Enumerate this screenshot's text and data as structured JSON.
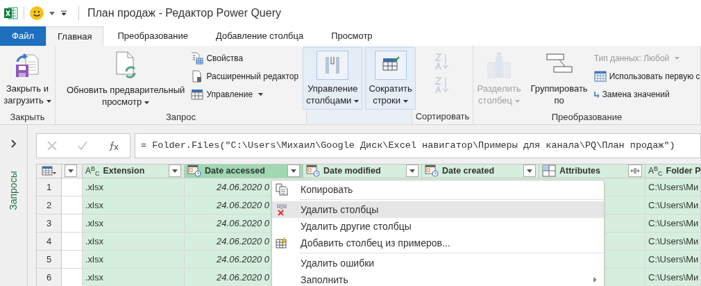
{
  "title_bar": {
    "title": "План продаж - Редактор Power Query"
  },
  "tabs": [
    {
      "label": "Файл",
      "kind": "file",
      "selected": false
    },
    {
      "label": "Главная",
      "kind": "tab",
      "selected": true
    },
    {
      "label": "Преобразование",
      "kind": "tab",
      "selected": false
    },
    {
      "label": "Добавление столбца",
      "kind": "tab",
      "selected": false
    },
    {
      "label": "Просмотр",
      "kind": "tab",
      "selected": false
    }
  ],
  "ribbon": {
    "groups": [
      {
        "label": "Закрыть",
        "items": [
          {
            "kind": "large",
            "lines": [
              "Закрыть и",
              "загрузить"
            ],
            "dropdown": true,
            "disabled": false,
            "highlighted": false
          }
        ]
      },
      {
        "label": "Запрос",
        "items": [
          {
            "kind": "large",
            "lines": [
              "Обновить предварительный",
              "просмотр"
            ],
            "dropdown": true,
            "disabled": false,
            "highlighted": false
          },
          {
            "kind": "small",
            "lines": [
              "Свойства"
            ],
            "dropdown": false,
            "disabled": false
          },
          {
            "kind": "small",
            "lines": [
              "Расширенный редактор"
            ],
            "dropdown": false,
            "disabled": false
          },
          {
            "kind": "small",
            "lines": [
              "Управление"
            ],
            "dropdown": true,
            "disabled": false
          }
        ]
      },
      {
        "items": [
          {
            "kind": "large",
            "lines": [
              "Управление",
              "столбцами"
            ],
            "dropdown": true,
            "disabled": false,
            "highlighted": true
          },
          {
            "kind": "large",
            "lines": [
              "Сократить",
              "строки"
            ],
            "dropdown": true,
            "disabled": false,
            "highlighted": true
          }
        ]
      },
      {
        "label": "Сортировать",
        "items": [
          {
            "kind": "sort",
            "disabled": true
          }
        ]
      },
      {
        "label": "Преобразование",
        "items": [
          {
            "kind": "large",
            "lines": [
              "Разделить",
              "столбец"
            ],
            "dropdown": true,
            "disabled": true,
            "highlighted": false
          },
          {
            "kind": "large",
            "lines": [
              "Группировать",
              "по"
            ],
            "dropdown": false,
            "disabled": false,
            "highlighted": false
          },
          {
            "kind": "small",
            "lines": [
              "Тип данных: Любой"
            ],
            "dropdown": true,
            "disabled": true
          },
          {
            "kind": "small",
            "lines": [
              "Использовать первую с"
            ],
            "dropdown": false,
            "disabled": false
          },
          {
            "kind": "small",
            "lines": [
              "Замена значений"
            ],
            "dropdown": false,
            "disabled": false
          }
        ]
      }
    ]
  },
  "queries_panel": {
    "label": "Запросы"
  },
  "formula_bar": {
    "formula": "= Folder.Files(\"C:\\Users\\Михаил\\Google Диск\\Excel навигатор\\Примеры для канала\\PQ\\План продаж\")"
  },
  "table": {
    "row_numbers": [
      "1",
      "2",
      "3",
      "4",
      "5",
      "6"
    ],
    "columns": [
      {
        "kind": "blank",
        "selected": false
      },
      {
        "kind": "text",
        "type_label": "A$^{B}$$_{C}$",
        "name": "Extension",
        "selected": false,
        "cells": [
          ".xlsx",
          ".xlsx",
          ".xlsx",
          ".xlsx",
          ".xlsx",
          ".xlsx"
        ]
      },
      {
        "kind": "datetime",
        "name": "Date accessed",
        "selected": true,
        "cells": [
          "24.06.2020 0",
          "24.06.2020 0",
          "24.06.2020 0",
          "24.06.2020 0",
          "24.06.2020 0",
          "24.06.2020 0"
        ]
      },
      {
        "kind": "datetime",
        "name": "Date modified",
        "selected": false
      },
      {
        "kind": "datetime",
        "name": "Date created",
        "selected": false
      },
      {
        "kind": "record",
        "name": "Attributes",
        "selected": false
      },
      {
        "kind": "text",
        "type_label": "A$^{B}$$_{C}$",
        "name": "Folder P",
        "selected": false,
        "cells": [
          "C:\\Users\\Ми",
          "C:\\Users\\Ми",
          "C:\\Users\\Ми",
          "C:\\Users\\Ми",
          "C:\\Users\\Ми",
          "C:\\Users\\Ми"
        ]
      }
    ]
  },
  "context_menu": {
    "items": [
      {
        "kind": "item",
        "label": "Копировать",
        "highlighted": false,
        "submenu": false
      },
      {
        "kind": "separator"
      },
      {
        "kind": "item",
        "label": "Удалить столбцы",
        "highlighted": true,
        "submenu": false
      },
      {
        "kind": "item",
        "label": "Удалить другие столбцы",
        "highlighted": false,
        "submenu": false
      },
      {
        "kind": "item",
        "label": "Добавить столбец из примеров...",
        "highlighted": false,
        "submenu": false
      },
      {
        "kind": "separator"
      },
      {
        "kind": "item",
        "label": "Удалить ошибки",
        "highlighted": false,
        "submenu": false
      },
      {
        "kind": "item",
        "label": "Заполнить",
        "highlighted": false,
        "submenu": true
      }
    ]
  }
}
